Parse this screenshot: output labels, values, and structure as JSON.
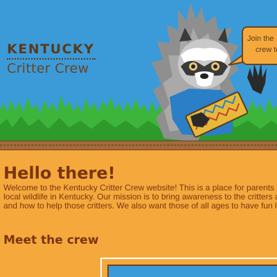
{
  "header": {
    "logo": {
      "line1": "KENTUCKY",
      "line2": "Critter Crew"
    },
    "speech_bubble": {
      "line1": "Join the",
      "line2": "crew to"
    },
    "mascot_icon": "raccoon-mascot-icon"
  },
  "main": {
    "heading": "Hello there!",
    "intro_lines": [
      "Welcome to the Kentucky Critter Crew website! This is a place for parents and",
      "local wildlife in Kentucky. Our mission is to bring awareness to the critters arou",
      "and how to help those critters. We also want those of all ages to have fun lear"
    ],
    "subheading": "Meet the crew"
  },
  "colors": {
    "sky": "#3b9bd8",
    "background": "#f5a93c",
    "heading_text": "#7a3410",
    "logo_text": "#5b3a1a",
    "grass": "#3db53a",
    "wood": "#a36a3b"
  }
}
